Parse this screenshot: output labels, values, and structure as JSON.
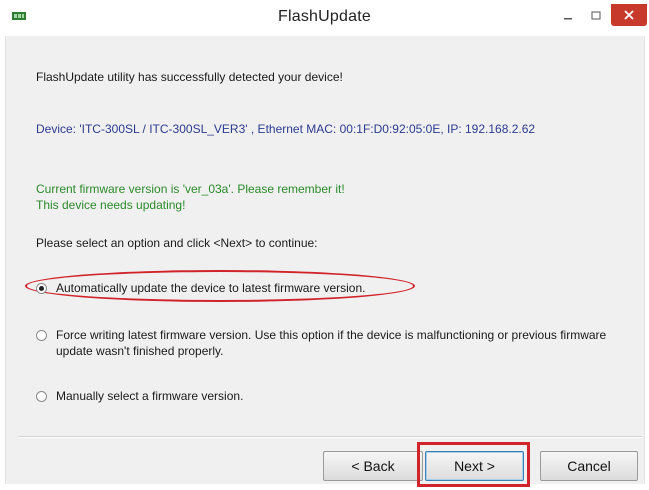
{
  "window": {
    "title": "FlashUpdate",
    "icon": "flash-chip-icon",
    "controls": {
      "minimize": "minimize-icon",
      "maximize": "maximize-icon",
      "close": "close-icon"
    }
  },
  "messages": {
    "detected": "FlashUpdate utility has successfully detected your device!",
    "device": "Device: 'ITC-300SL / ITC-300SL_VER3' , Ethernet MAC: 00:1F:D0:92:05:0E, IP: 192.168.2.62",
    "firmware_line1": "Current firmware version is 'ver_03a'. Please remember it!",
    "firmware_line2": "This device needs updating!",
    "prompt": "Please select an option and click <Next> to continue:"
  },
  "options": [
    {
      "label": "Automatically update the device to latest firmware version.",
      "selected": true
    },
    {
      "label": "Force writing latest firmware version. Use this option if the device is malfunctioning or previous firmware update wasn't finished properly.",
      "selected": false
    },
    {
      "label": "Manually select a firmware version.",
      "selected": false
    }
  ],
  "buttons": {
    "back": "< Back",
    "next": "Next >",
    "cancel": "Cancel"
  },
  "colors": {
    "device_text": "#2b3b8f",
    "firmware_text": "#2b8a2b",
    "highlight": "#d0242a"
  }
}
